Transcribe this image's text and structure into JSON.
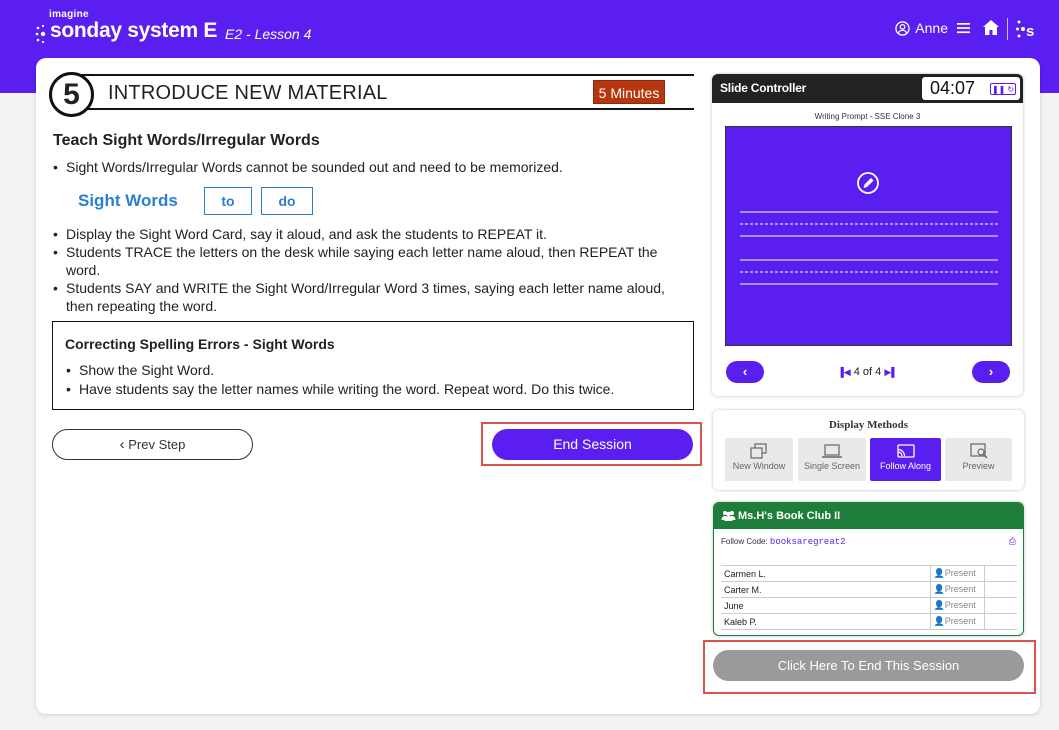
{
  "header": {
    "brand_small": "imagine",
    "brand_name": "sonday system E",
    "lesson": "E2 - Lesson 4",
    "user_name": "Anne",
    "accent_color": "#5a1ff0",
    "icons": [
      "user-circle-icon",
      "hamburger-menu-icon",
      "home-icon",
      "sonday-logo-icon"
    ]
  },
  "step": {
    "number": "5",
    "title": "INTRODUCE NEW MATERIAL",
    "duration": "5 Minutes"
  },
  "content": {
    "heading": "Teach Sight Words/Irregular Words",
    "intro_bullet": "Sight Words/Irregular Words cannot be sounded out and need to be memorized.",
    "sight_words_label": "Sight Words",
    "sight_words": [
      "to",
      "do"
    ],
    "bullets": [
      "Display the Sight Word Card, say it aloud, and ask the students to REPEAT it.",
      "Students TRACE the letters on the desk while saying each letter name aloud, then REPEAT the word.",
      "Students SAY and WRITE the Sight Word/Irregular Word 3 times, saying each letter name aloud, then repeating the word."
    ],
    "correcting": {
      "title": "Correcting Spelling Errors - Sight Words",
      "bullets": [
        "Show the Sight Word.",
        "Have students say the letter names while writing the word. Repeat word. Do this twice."
      ]
    },
    "prev_label": "Prev Step",
    "end_session_label": "End Session"
  },
  "slide_controller": {
    "title": "Slide Controller",
    "timer": "04:07",
    "caption": "Writing Prompt - SSE Clone 3",
    "page_indicator": "4 of 4"
  },
  "display_methods": {
    "title": "Display Methods",
    "options": [
      {
        "label": "New Window",
        "icon": "new-window-icon"
      },
      {
        "label": "Single Screen",
        "icon": "laptop-icon"
      },
      {
        "label": "Follow Along",
        "icon": "cast-icon",
        "active": true
      },
      {
        "label": "Preview",
        "icon": "preview-icon"
      }
    ]
  },
  "club": {
    "title": "Ms.H's Book Club II",
    "follow_code_label": "Follow Code:",
    "follow_code": "booksaregreat2",
    "color": "#1e7d3a",
    "students": [
      {
        "name": "Carmen L.",
        "status": "Present"
      },
      {
        "name": "Carter M.",
        "status": "Present"
      },
      {
        "name": "June",
        "status": "Present"
      },
      {
        "name": "Kaleb P.",
        "status": "Present"
      }
    ]
  },
  "end_this_session_label": "Click Here To End This Session"
}
